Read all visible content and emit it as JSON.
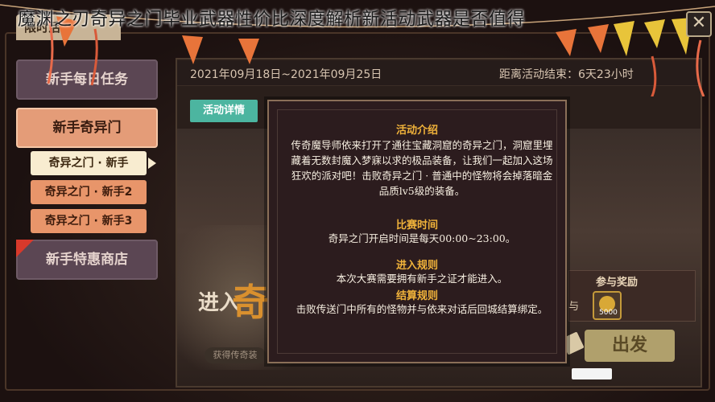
{
  "page_title_overlay": "魔渊之刃奇异之门毕业武器性价比深度解析新活动武器是否值得",
  "header": {
    "tab_label": "限时活动",
    "close_label": "✕"
  },
  "sidebar": {
    "items": [
      {
        "label": "新手每日任务"
      },
      {
        "label": "新手奇异门"
      },
      {
        "label": "新手特惠商店"
      }
    ],
    "sub_items": [
      {
        "label": "奇异之门 · 新手"
      },
      {
        "label": "奇异之门 · 新手2"
      },
      {
        "label": "奇异之门 · 新手3"
      }
    ]
  },
  "main": {
    "date_range": "2021年09月18日~2021年09月25日",
    "countdown": "距离活动结束：6天23小时",
    "detail_button": "活动详情",
    "banner_enter": "进入",
    "banner_char": "奇",
    "banner_caption": "获得传奇装"
  },
  "dialog": {
    "sections": [
      {
        "heading": "活动介绍",
        "body": "传奇魔导师依来打开了通往宝藏洞窟的奇异之门，洞窟里埋藏着无数封魔入梦寐以求的极品装备，让我们一起加入这场狂欢的派对吧！击败奇异之门 · 普通中的怪物将会掉落暗金品质lv5级的装备。"
      },
      {
        "heading": "比赛时间",
        "body": "奇异之门开启时间是每天00:00~23:00。"
      },
      {
        "heading": "进入规则",
        "body": "本次大赛需要拥有新手之证才能进入。"
      },
      {
        "heading": "结算规则",
        "body": "击败传送门中所有的怪物并与依来对话后回城结算绑定。"
      }
    ]
  },
  "rewards": {
    "title": "参与奖励",
    "partial_label": "与",
    "item_qty": "5000",
    "depart_button": "出发"
  },
  "watermark": "",
  "colors": {
    "active_tab": "#e49c78",
    "sub_active": "#f8ecd0",
    "detail_button": "#4cb5a0",
    "dialog_heading": "#f0b23a"
  }
}
